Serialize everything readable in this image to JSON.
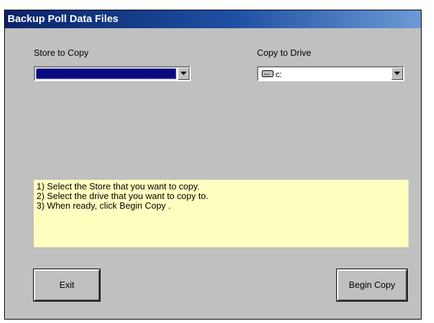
{
  "window": {
    "title": "Backup Poll Data Files"
  },
  "store": {
    "label": "Store to Copy",
    "value": ""
  },
  "drive": {
    "label": "Copy to Drive",
    "value": "c:",
    "icon": "drive-icon"
  },
  "instructions": [
    "1) Select the Store that you want to copy.",
    "2) Select the drive that you want to copy to.",
    "3) When ready, click Begin Copy ."
  ],
  "buttons": {
    "exit": "Exit",
    "begin_copy": "Begin Copy"
  },
  "colors": {
    "title_bar": "#0a246a",
    "instruction_bg": "#ffffc0",
    "selection": "#0a0a80",
    "face": "#c0c0c0"
  }
}
